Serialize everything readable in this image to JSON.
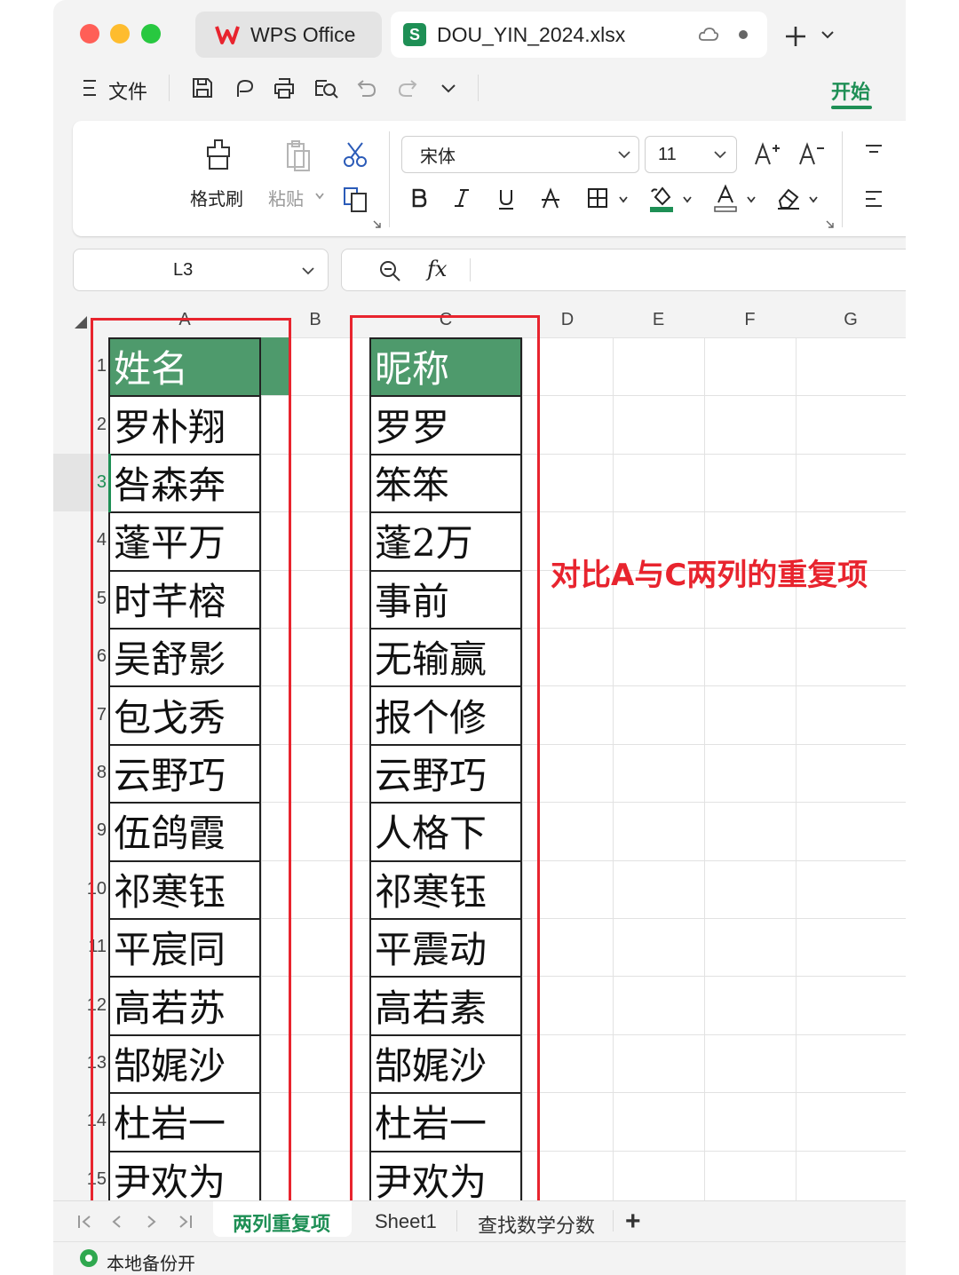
{
  "titlebar": {
    "tabs": [
      {
        "label": "WPS Office"
      },
      {
        "label": "DOU_YIN_2024.xlsx"
      }
    ],
    "traffic_colors": [
      "#ff5f57",
      "#febc2e",
      "#28c840"
    ]
  },
  "menu": {
    "file_label": "文件",
    "start_tab_label": "开始",
    "accent": "#1e8f55"
  },
  "ribbon": {
    "format_painter_label": "格式刷",
    "paste_label": "粘贴",
    "font_name": "宋体",
    "font_size": "11"
  },
  "namebox": {
    "value": "L3"
  },
  "formula": {
    "fx_label": "fx",
    "value": ""
  },
  "sheet": {
    "columns": [
      "A",
      "B",
      "C",
      "D",
      "E",
      "F",
      "G"
    ],
    "rows": [
      "1",
      "2",
      "3",
      "4",
      "5",
      "6",
      "7",
      "8",
      "9",
      "10",
      "11",
      "12",
      "13",
      "14",
      "15"
    ],
    "header_fill": "#4e9a6c",
    "col_a": [
      "姓名",
      "罗朴翔",
      "咎森奔",
      "蓬平万",
      "时芊榕",
      "吴舒影",
      "包戈秀",
      "云野巧",
      "伍鸽霞",
      "祁寒钰",
      "平宸同",
      "高若苏",
      "郜娓沙",
      "杜岩一",
      "尹欢为"
    ],
    "col_c": [
      "昵称",
      "罗罗",
      "笨笨",
      "蓬2万",
      "事前",
      "无输赢",
      "报个修",
      "云野巧",
      "人格下",
      "祁寒钰",
      "平震动",
      "高若素",
      "郜娓沙",
      "杜岩一",
      "尹欢为"
    ],
    "annotation": "对比A与C两列的重复项",
    "annotation_color": "#e8242e"
  },
  "sheet_tabs": {
    "items": [
      "两列重复项",
      "Sheet1",
      "查找数学分数"
    ],
    "add_label": "+"
  },
  "status": {
    "backup_label": "本地备份开"
  }
}
